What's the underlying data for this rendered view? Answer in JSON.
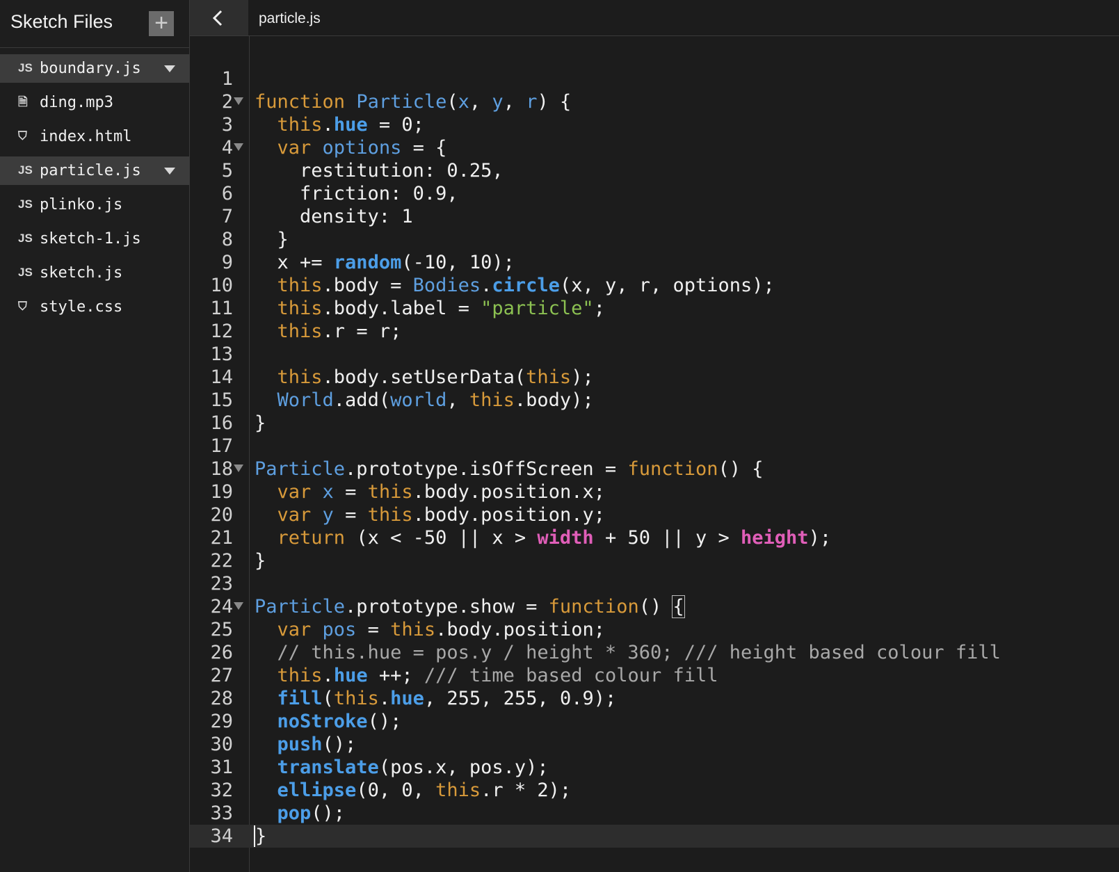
{
  "sidebar": {
    "title": "Sketch Files",
    "add_label": "+",
    "files": [
      {
        "name": "boundary.js",
        "icon": "JS",
        "icon_name": "js-file-icon",
        "has_menu": true,
        "selected": true
      },
      {
        "name": "ding.mp3",
        "icon": "🗎",
        "icon_name": "document-icon",
        "has_menu": false,
        "selected": false
      },
      {
        "name": "index.html",
        "icon": "⛉",
        "icon_name": "html5-icon",
        "has_menu": false,
        "selected": false
      },
      {
        "name": "particle.js",
        "icon": "JS",
        "icon_name": "js-file-icon",
        "has_menu": true,
        "selected": true
      },
      {
        "name": "plinko.js",
        "icon": "JS",
        "icon_name": "js-file-icon",
        "has_menu": false,
        "selected": false
      },
      {
        "name": "sketch-1.js",
        "icon": "JS",
        "icon_name": "js-file-icon",
        "has_menu": false,
        "selected": false
      },
      {
        "name": "sketch.js",
        "icon": "JS",
        "icon_name": "js-file-icon",
        "has_menu": false,
        "selected": false
      },
      {
        "name": "style.css",
        "icon": "⛉",
        "icon_name": "css3-icon",
        "has_menu": false,
        "selected": false
      }
    ]
  },
  "topbar": {
    "back_icon": "chevron-left-icon",
    "filename": "particle.js"
  },
  "editor": {
    "active_line": 34,
    "colors": {
      "keyword": "#d89a3a",
      "variable": "#5e9fe0",
      "function": "#4c9ee8",
      "string": "#8cc152",
      "comment": "#a8a8a8",
      "builtin": "#e05eb8",
      "plain": "#f0f0f0"
    },
    "lines": [
      {
        "n": "1",
        "fold": false,
        "tokens": []
      },
      {
        "n": "2",
        "fold": true,
        "tokens": [
          [
            "k",
            "function "
          ],
          [
            "v",
            "Particle"
          ],
          [
            "p",
            "("
          ],
          [
            "v",
            "x"
          ],
          [
            "p",
            ", "
          ],
          [
            "v",
            "y"
          ],
          [
            "p",
            ", "
          ],
          [
            "v",
            "r"
          ],
          [
            "p",
            ") {"
          ]
        ]
      },
      {
        "n": "3",
        "fold": false,
        "tokens": [
          [
            "p",
            "  "
          ],
          [
            "k",
            "this"
          ],
          [
            "p",
            "."
          ],
          [
            "f",
            "hue"
          ],
          [
            "p",
            " = 0;"
          ]
        ]
      },
      {
        "n": "4",
        "fold": true,
        "tokens": [
          [
            "p",
            "  "
          ],
          [
            "k",
            "var "
          ],
          [
            "v",
            "options"
          ],
          [
            "p",
            " = {"
          ]
        ]
      },
      {
        "n": "5",
        "fold": false,
        "tokens": [
          [
            "p",
            "    restitution: 0.25,"
          ]
        ]
      },
      {
        "n": "6",
        "fold": false,
        "tokens": [
          [
            "p",
            "    friction: 0.9,"
          ]
        ]
      },
      {
        "n": "7",
        "fold": false,
        "tokens": [
          [
            "p",
            "    density: 1"
          ]
        ]
      },
      {
        "n": "8",
        "fold": false,
        "tokens": [
          [
            "p",
            "  }"
          ]
        ]
      },
      {
        "n": "9",
        "fold": false,
        "tokens": [
          [
            "p",
            "  x += "
          ],
          [
            "f",
            "random"
          ],
          [
            "p",
            "(-10, 10);"
          ]
        ]
      },
      {
        "n": "10",
        "fold": false,
        "tokens": [
          [
            "p",
            "  "
          ],
          [
            "k",
            "this"
          ],
          [
            "p",
            ".body = "
          ],
          [
            "v",
            "Bodies"
          ],
          [
            "p",
            "."
          ],
          [
            "f",
            "circle"
          ],
          [
            "p",
            "(x, y, r, options);"
          ]
        ]
      },
      {
        "n": "11",
        "fold": false,
        "tokens": [
          [
            "p",
            "  "
          ],
          [
            "k",
            "this"
          ],
          [
            "p",
            ".body.label = "
          ],
          [
            "s",
            "\"particle\""
          ],
          [
            "p",
            ";"
          ]
        ]
      },
      {
        "n": "12",
        "fold": false,
        "tokens": [
          [
            "p",
            "  "
          ],
          [
            "k",
            "this"
          ],
          [
            "p",
            ".r = r;"
          ]
        ]
      },
      {
        "n": "13",
        "fold": false,
        "tokens": []
      },
      {
        "n": "14",
        "fold": false,
        "tokens": [
          [
            "p",
            "  "
          ],
          [
            "k",
            "this"
          ],
          [
            "p",
            ".body.setUserData("
          ],
          [
            "k",
            "this"
          ],
          [
            "p",
            ");"
          ]
        ]
      },
      {
        "n": "15",
        "fold": false,
        "tokens": [
          [
            "p",
            "  "
          ],
          [
            "v",
            "World"
          ],
          [
            "p",
            ".add("
          ],
          [
            "v",
            "world"
          ],
          [
            "p",
            ", "
          ],
          [
            "k",
            "this"
          ],
          [
            "p",
            ".body);"
          ]
        ]
      },
      {
        "n": "16",
        "fold": false,
        "tokens": [
          [
            "p",
            "}"
          ]
        ]
      },
      {
        "n": "17",
        "fold": false,
        "tokens": []
      },
      {
        "n": "18",
        "fold": true,
        "tokens": [
          [
            "v",
            "Particle"
          ],
          [
            "p",
            ".prototype.isOffScreen = "
          ],
          [
            "k",
            "function"
          ],
          [
            "p",
            "() {"
          ]
        ]
      },
      {
        "n": "19",
        "fold": false,
        "tokens": [
          [
            "p",
            "  "
          ],
          [
            "k",
            "var "
          ],
          [
            "v",
            "x"
          ],
          [
            "p",
            " = "
          ],
          [
            "k",
            "this"
          ],
          [
            "p",
            ".body.position.x;"
          ]
        ]
      },
      {
        "n": "20",
        "fold": false,
        "tokens": [
          [
            "p",
            "  "
          ],
          [
            "k",
            "var "
          ],
          [
            "v",
            "y"
          ],
          [
            "p",
            " = "
          ],
          [
            "k",
            "this"
          ],
          [
            "p",
            ".body.position.y;"
          ]
        ]
      },
      {
        "n": "21",
        "fold": false,
        "tokens": [
          [
            "p",
            "  "
          ],
          [
            "k",
            "return"
          ],
          [
            "p",
            " (x < -50 || x > "
          ],
          [
            "m",
            "width"
          ],
          [
            "p",
            " + 50 || y > "
          ],
          [
            "m",
            "height"
          ],
          [
            "p",
            ");"
          ]
        ]
      },
      {
        "n": "22",
        "fold": false,
        "tokens": [
          [
            "p",
            "}"
          ]
        ]
      },
      {
        "n": "23",
        "fold": false,
        "tokens": []
      },
      {
        "n": "24",
        "fold": true,
        "tokens": [
          [
            "v",
            "Particle"
          ],
          [
            "p",
            ".prototype.show = "
          ],
          [
            "k",
            "function"
          ],
          [
            "p",
            "() "
          ],
          [
            "bm",
            "{"
          ]
        ]
      },
      {
        "n": "25",
        "fold": false,
        "tokens": [
          [
            "p",
            "  "
          ],
          [
            "k",
            "var "
          ],
          [
            "v",
            "pos"
          ],
          [
            "p",
            " = "
          ],
          [
            "k",
            "this"
          ],
          [
            "p",
            ".body.position;"
          ]
        ]
      },
      {
        "n": "26",
        "fold": false,
        "tokens": [
          [
            "p",
            "  "
          ],
          [
            "c",
            "// this.hue = pos.y / height * 360; /// height based colour fill"
          ]
        ]
      },
      {
        "n": "27",
        "fold": false,
        "tokens": [
          [
            "p",
            "  "
          ],
          [
            "k",
            "this"
          ],
          [
            "p",
            "."
          ],
          [
            "f",
            "hue"
          ],
          [
            "p",
            " ++; "
          ],
          [
            "c",
            "/// time based colour fill"
          ]
        ]
      },
      {
        "n": "28",
        "fold": false,
        "tokens": [
          [
            "p",
            "  "
          ],
          [
            "f",
            "fill"
          ],
          [
            "p",
            "("
          ],
          [
            "k",
            "this"
          ],
          [
            "p",
            "."
          ],
          [
            "f",
            "hue"
          ],
          [
            "p",
            ", 255, 255, 0.9);"
          ]
        ]
      },
      {
        "n": "29",
        "fold": false,
        "tokens": [
          [
            "p",
            "  "
          ],
          [
            "f",
            "noStroke"
          ],
          [
            "p",
            "();"
          ]
        ]
      },
      {
        "n": "30",
        "fold": false,
        "tokens": [
          [
            "p",
            "  "
          ],
          [
            "f",
            "push"
          ],
          [
            "p",
            "();"
          ]
        ]
      },
      {
        "n": "31",
        "fold": false,
        "tokens": [
          [
            "p",
            "  "
          ],
          [
            "f",
            "translate"
          ],
          [
            "p",
            "(pos.x, pos.y);"
          ]
        ]
      },
      {
        "n": "32",
        "fold": false,
        "tokens": [
          [
            "p",
            "  "
          ],
          [
            "f",
            "ellipse"
          ],
          [
            "p",
            "(0, 0, "
          ],
          [
            "k",
            "this"
          ],
          [
            "p",
            ".r * 2);"
          ]
        ]
      },
      {
        "n": "33",
        "fold": false,
        "tokens": [
          [
            "p",
            "  "
          ],
          [
            "f",
            "pop"
          ],
          [
            "p",
            "();"
          ]
        ]
      },
      {
        "n": "34",
        "fold": false,
        "tokens": [
          [
            "bmc",
            "}"
          ]
        ]
      }
    ]
  }
}
